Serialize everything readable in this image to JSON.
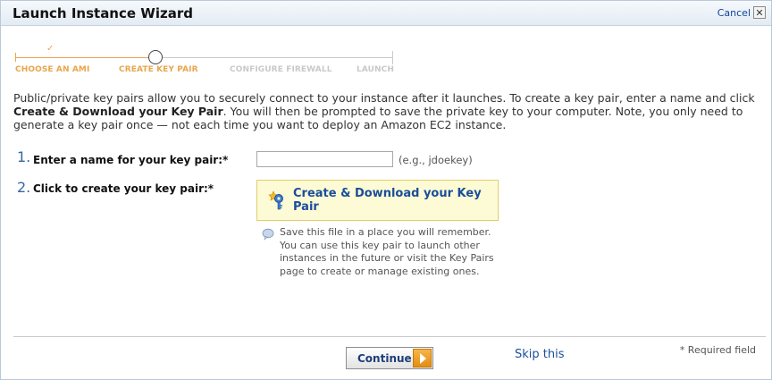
{
  "window": {
    "title": "Launch Instance Wizard",
    "cancel_label": "Cancel",
    "close_glyph": "✕"
  },
  "stepper": {
    "check_glyph": "✓",
    "steps": [
      {
        "label": "CHOOSE AN AMI",
        "state": "done"
      },
      {
        "label": "CREATE KEY PAIR",
        "state": "current"
      },
      {
        "label": "CONFIGURE FIREWALL",
        "state": "todo"
      },
      {
        "label": "LAUNCH",
        "state": "todo"
      }
    ]
  },
  "intro": {
    "part1": "Public/private key pairs allow you to securely connect to your instance after it launches. To create a key pair, enter a name and click ",
    "bold": "Create & Download your Key Pair",
    "part2": ". You will then be prompted to save the private key to your computer. Note, you only need to generate a key pair once — not each time you want to deploy an Amazon EC2 instance."
  },
  "form": {
    "step1_number": "1.",
    "step1_label": "Enter a name for your key pair:*",
    "key_name_value": "",
    "key_name_hint": "(e.g., jdoekey)",
    "step2_number": "2.",
    "step2_label": "Click to create your key pair:*",
    "create_button_label": "Create & Download your Key Pair",
    "save_note": "Save this file in a place you will remember. You can use this key pair to launch other instances in the future or visit the Key Pairs page to create or manage existing ones."
  },
  "footer": {
    "continue_label": "Continue",
    "skip_label": "Skip this",
    "required_note": "* Required field"
  },
  "colors": {
    "accent_orange": "#e8a64e",
    "link_blue": "#1a4d9c",
    "create_button_bg": "#fdfbd5"
  },
  "icons": {
    "close": "close-icon",
    "step_done": "check-icon",
    "create": "key-icon",
    "note": "info-icon",
    "continue": "arrow-right-icon"
  }
}
